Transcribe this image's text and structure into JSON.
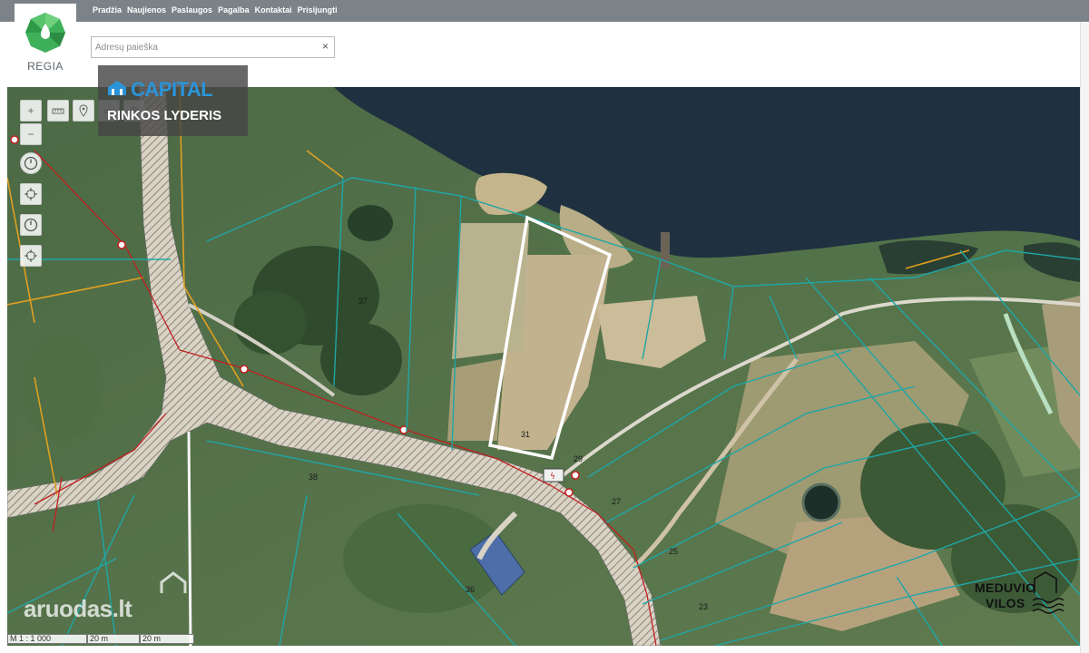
{
  "app": {
    "logo_text": "REGIA",
    "nav_items": [
      "Pradžia",
      "Naujienos",
      "Paslaugos",
      "Pagalba",
      "Kontaktai",
      "Prisijungti"
    ]
  },
  "search": {
    "placeholder": "Adresų paieška",
    "value": "",
    "clear_icon": "×"
  },
  "banner": {
    "brand": "CAPITAL",
    "slogan": "RINKOS LYDERIS"
  },
  "map": {
    "plot_numbers": [
      "37",
      "31",
      "29",
      "27",
      "25",
      "23",
      "38",
      "36"
    ],
    "scale_text": "M 1 : 1 000",
    "scale_segments": [
      "20 m",
      "20 m"
    ]
  },
  "watermarks": {
    "site": "aruodas.lt",
    "developer_line1": "MEDUVIO",
    "developer_line2": "VILOS"
  },
  "colors": {
    "topbar": "#7b8388",
    "cadastre_line": "#1fa6a6",
    "road_line": "#e0a020",
    "utility_line": "#c02020",
    "highlight": "#ffffff",
    "water": "#1f3140"
  },
  "icons": [
    "zoom-in-icon",
    "zoom-out-icon",
    "ruler-icon",
    "location-pin-icon",
    "layers-icon",
    "compass-icon",
    "clock-icon",
    "crosshair-icon"
  ]
}
